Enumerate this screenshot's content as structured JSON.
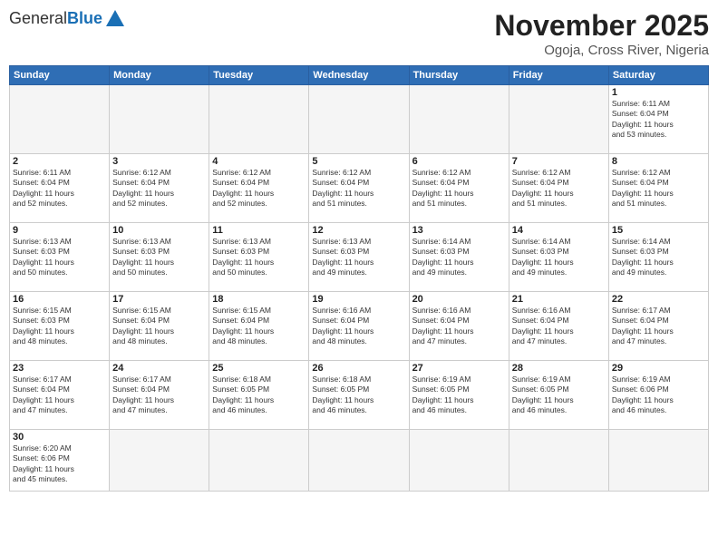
{
  "header": {
    "logo_general": "General",
    "logo_blue": "Blue",
    "month_title": "November 2025",
    "location": "Ogoja, Cross River, Nigeria"
  },
  "days_of_week": [
    "Sunday",
    "Monday",
    "Tuesday",
    "Wednesday",
    "Thursday",
    "Friday",
    "Saturday"
  ],
  "weeks": [
    [
      {
        "day": "",
        "info": ""
      },
      {
        "day": "",
        "info": ""
      },
      {
        "day": "",
        "info": ""
      },
      {
        "day": "",
        "info": ""
      },
      {
        "day": "",
        "info": ""
      },
      {
        "day": "",
        "info": ""
      },
      {
        "day": "1",
        "info": "Sunrise: 6:11 AM\nSunset: 6:04 PM\nDaylight: 11 hours\nand 53 minutes."
      }
    ],
    [
      {
        "day": "2",
        "info": "Sunrise: 6:11 AM\nSunset: 6:04 PM\nDaylight: 11 hours\nand 52 minutes."
      },
      {
        "day": "3",
        "info": "Sunrise: 6:12 AM\nSunset: 6:04 PM\nDaylight: 11 hours\nand 52 minutes."
      },
      {
        "day": "4",
        "info": "Sunrise: 6:12 AM\nSunset: 6:04 PM\nDaylight: 11 hours\nand 52 minutes."
      },
      {
        "day": "5",
        "info": "Sunrise: 6:12 AM\nSunset: 6:04 PM\nDaylight: 11 hours\nand 51 minutes."
      },
      {
        "day": "6",
        "info": "Sunrise: 6:12 AM\nSunset: 6:04 PM\nDaylight: 11 hours\nand 51 minutes."
      },
      {
        "day": "7",
        "info": "Sunrise: 6:12 AM\nSunset: 6:04 PM\nDaylight: 11 hours\nand 51 minutes."
      },
      {
        "day": "8",
        "info": "Sunrise: 6:12 AM\nSunset: 6:04 PM\nDaylight: 11 hours\nand 51 minutes."
      }
    ],
    [
      {
        "day": "9",
        "info": "Sunrise: 6:13 AM\nSunset: 6:03 PM\nDaylight: 11 hours\nand 50 minutes."
      },
      {
        "day": "10",
        "info": "Sunrise: 6:13 AM\nSunset: 6:03 PM\nDaylight: 11 hours\nand 50 minutes."
      },
      {
        "day": "11",
        "info": "Sunrise: 6:13 AM\nSunset: 6:03 PM\nDaylight: 11 hours\nand 50 minutes."
      },
      {
        "day": "12",
        "info": "Sunrise: 6:13 AM\nSunset: 6:03 PM\nDaylight: 11 hours\nand 49 minutes."
      },
      {
        "day": "13",
        "info": "Sunrise: 6:14 AM\nSunset: 6:03 PM\nDaylight: 11 hours\nand 49 minutes."
      },
      {
        "day": "14",
        "info": "Sunrise: 6:14 AM\nSunset: 6:03 PM\nDaylight: 11 hours\nand 49 minutes."
      },
      {
        "day": "15",
        "info": "Sunrise: 6:14 AM\nSunset: 6:03 PM\nDaylight: 11 hours\nand 49 minutes."
      }
    ],
    [
      {
        "day": "16",
        "info": "Sunrise: 6:15 AM\nSunset: 6:03 PM\nDaylight: 11 hours\nand 48 minutes."
      },
      {
        "day": "17",
        "info": "Sunrise: 6:15 AM\nSunset: 6:04 PM\nDaylight: 11 hours\nand 48 minutes."
      },
      {
        "day": "18",
        "info": "Sunrise: 6:15 AM\nSunset: 6:04 PM\nDaylight: 11 hours\nand 48 minutes."
      },
      {
        "day": "19",
        "info": "Sunrise: 6:16 AM\nSunset: 6:04 PM\nDaylight: 11 hours\nand 48 minutes."
      },
      {
        "day": "20",
        "info": "Sunrise: 6:16 AM\nSunset: 6:04 PM\nDaylight: 11 hours\nand 47 minutes."
      },
      {
        "day": "21",
        "info": "Sunrise: 6:16 AM\nSunset: 6:04 PM\nDaylight: 11 hours\nand 47 minutes."
      },
      {
        "day": "22",
        "info": "Sunrise: 6:17 AM\nSunset: 6:04 PM\nDaylight: 11 hours\nand 47 minutes."
      }
    ],
    [
      {
        "day": "23",
        "info": "Sunrise: 6:17 AM\nSunset: 6:04 PM\nDaylight: 11 hours\nand 47 minutes."
      },
      {
        "day": "24",
        "info": "Sunrise: 6:17 AM\nSunset: 6:04 PM\nDaylight: 11 hours\nand 47 minutes."
      },
      {
        "day": "25",
        "info": "Sunrise: 6:18 AM\nSunset: 6:05 PM\nDaylight: 11 hours\nand 46 minutes."
      },
      {
        "day": "26",
        "info": "Sunrise: 6:18 AM\nSunset: 6:05 PM\nDaylight: 11 hours\nand 46 minutes."
      },
      {
        "day": "27",
        "info": "Sunrise: 6:19 AM\nSunset: 6:05 PM\nDaylight: 11 hours\nand 46 minutes."
      },
      {
        "day": "28",
        "info": "Sunrise: 6:19 AM\nSunset: 6:05 PM\nDaylight: 11 hours\nand 46 minutes."
      },
      {
        "day": "29",
        "info": "Sunrise: 6:19 AM\nSunset: 6:06 PM\nDaylight: 11 hours\nand 46 minutes."
      }
    ],
    [
      {
        "day": "30",
        "info": "Sunrise: 6:20 AM\nSunset: 6:06 PM\nDaylight: 11 hours\nand 45 minutes."
      },
      {
        "day": "",
        "info": ""
      },
      {
        "day": "",
        "info": ""
      },
      {
        "day": "",
        "info": ""
      },
      {
        "day": "",
        "info": ""
      },
      {
        "day": "",
        "info": ""
      },
      {
        "day": "",
        "info": ""
      }
    ]
  ]
}
